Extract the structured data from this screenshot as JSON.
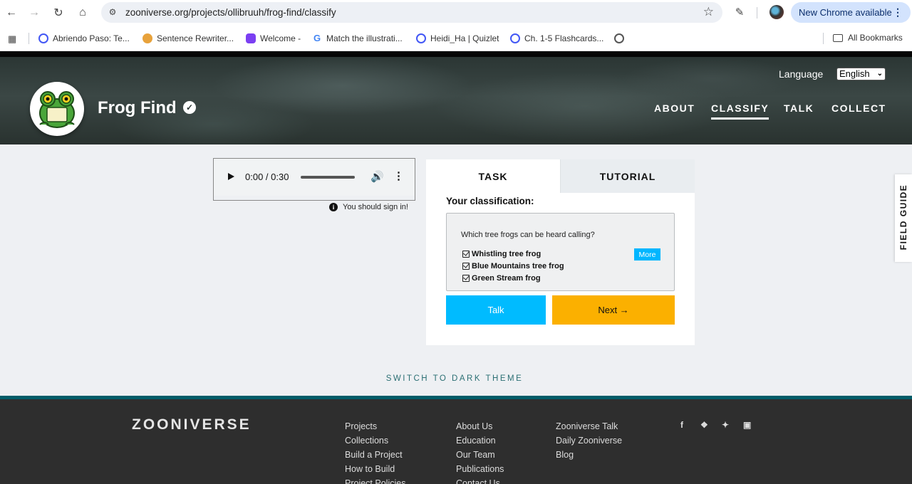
{
  "browser": {
    "url": "zooniverse.org/projects/ollibruuh/frog-find/classify",
    "update_label": "New Chrome available",
    "bookmarks": [
      "Abriendo Paso: Te...",
      "Sentence Rewriter...",
      "Welcome -",
      "Match the illustrati...",
      "Heidi_Ha | Quizlet",
      "Ch. 1-5 Flashcards..."
    ],
    "all_bookmarks": "All Bookmarks"
  },
  "header": {
    "project_title": "Frog Find",
    "language_label": "Language",
    "language_value": "English",
    "nav": [
      "ABOUT",
      "CLASSIFY",
      "TALK",
      "COLLECT"
    ],
    "active_nav": "CLASSIFY"
  },
  "audio": {
    "time": "0:00 / 0:30",
    "progress": 0
  },
  "notice": "You should sign in!",
  "task": {
    "tabs": [
      "TASK",
      "TUTORIAL"
    ],
    "heading": "Your classification:",
    "question": "Which tree frogs can be heard calling?",
    "options": [
      "Whistling tree frog",
      "Blue Mountains tree frog",
      "Green Stream frog"
    ],
    "more_label": "More",
    "talk_label": "Talk",
    "next_label": "Next →"
  },
  "field_guide": "FIELD GUIDE",
  "switch_theme": "SWITCH TO DARK THEME",
  "footer": {
    "logo": "ZOONIVERSE",
    "col1": [
      "Projects",
      "Collections",
      "Build a Project",
      "How to Build",
      "Project Policies"
    ],
    "col2": [
      "About Us",
      "Education",
      "Our Team",
      "Publications",
      "Contact Us"
    ],
    "col3": [
      "Zooniverse Talk",
      "Daily Zooniverse",
      "Blog"
    ],
    "social_icons": [
      "facebook-icon",
      "twitter-icon",
      "bluesky-icon",
      "instagram-icon"
    ]
  },
  "colors": {
    "accent_blue": "#00bbff",
    "next_yellow": "#fbb000",
    "footer_teal": "#005d69"
  }
}
